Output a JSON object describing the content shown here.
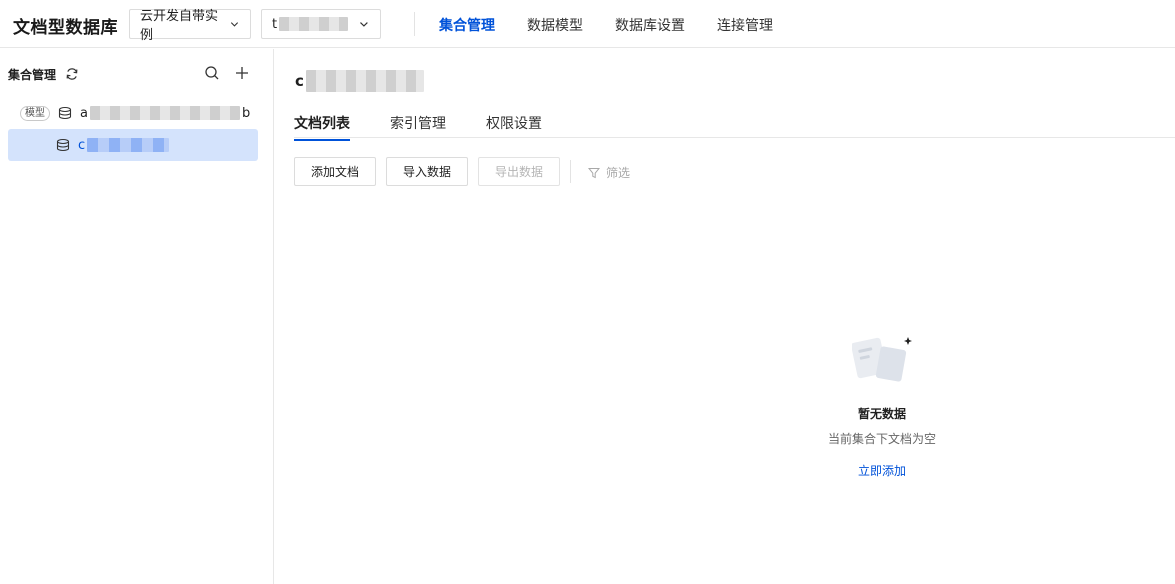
{
  "header": {
    "app_title": "文档型数据库",
    "env_select": {
      "label": "云开发自带实例"
    },
    "db_select": {
      "label_prefix": "t"
    },
    "nav": [
      {
        "label": "集合管理",
        "active": true
      },
      {
        "label": "数据模型",
        "active": false
      },
      {
        "label": "数据库设置",
        "active": false
      },
      {
        "label": "连接管理",
        "active": false
      }
    ]
  },
  "sidebar": {
    "title": "集合管理",
    "items": [
      {
        "badge": "模型",
        "name_prefix": "a",
        "name_suffix": "b",
        "selected": false
      },
      {
        "name_prefix": "c",
        "selected": true
      }
    ]
  },
  "main": {
    "collection_title_prefix": "c",
    "tabs": [
      {
        "label": "文档列表",
        "active": true
      },
      {
        "label": "索引管理",
        "active": false
      },
      {
        "label": "权限设置",
        "active": false
      }
    ],
    "actions": {
      "add": "添加文档",
      "import": "导入数据",
      "export": "导出数据",
      "filter": "筛选"
    },
    "empty": {
      "title": "暂无数据",
      "desc": "当前集合下文档为空",
      "link": "立即添加"
    }
  },
  "colors": {
    "primary": "#0052d9",
    "selected_bg": "#d4e3fc",
    "border": "#e7e7e7"
  }
}
